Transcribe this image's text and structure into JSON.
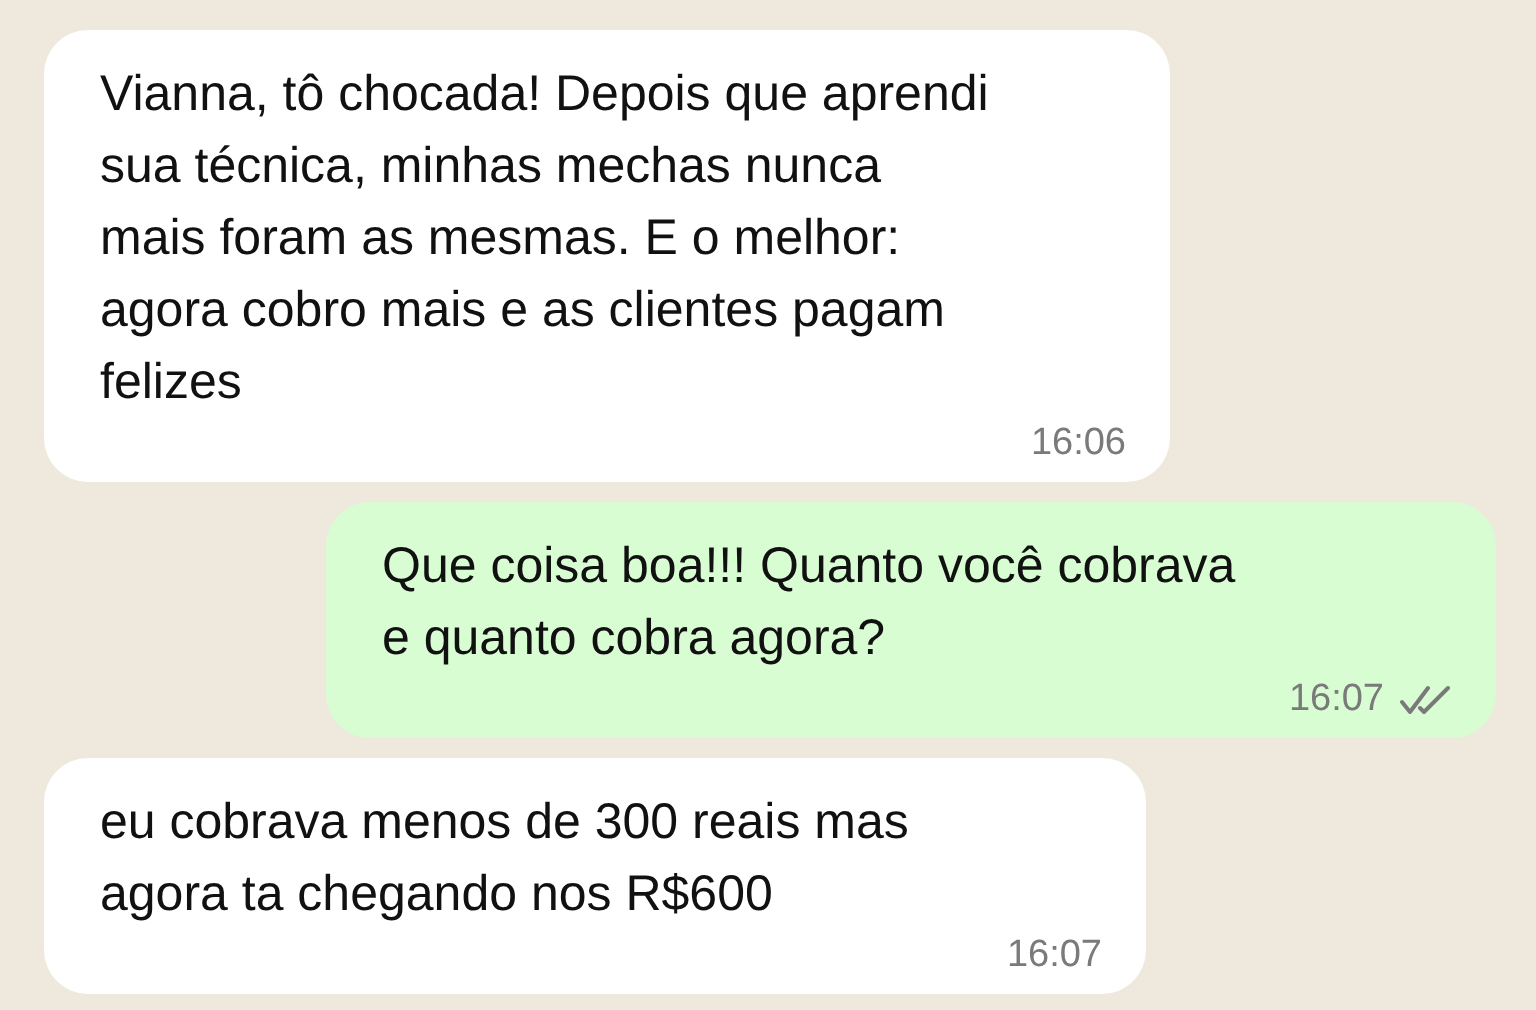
{
  "messages": [
    {
      "kind": "incoming",
      "text": "Vianna, tô chocada! Depois que aprendi sua técnica, minhas mechas nunca mais foram as mesmas. E o melhor: agora cobro mais e as clientes pagam felizes",
      "time": "16:06"
    },
    {
      "kind": "outgoing",
      "text": "Que coisa boa!!! Quanto você cobrava e quanto cobra agora?",
      "time": "16:07",
      "read": false
    },
    {
      "kind": "incoming",
      "text": "eu cobrava menos de 300 reais mas agora ta chegando nos R$600",
      "time": "16:07"
    }
  ]
}
